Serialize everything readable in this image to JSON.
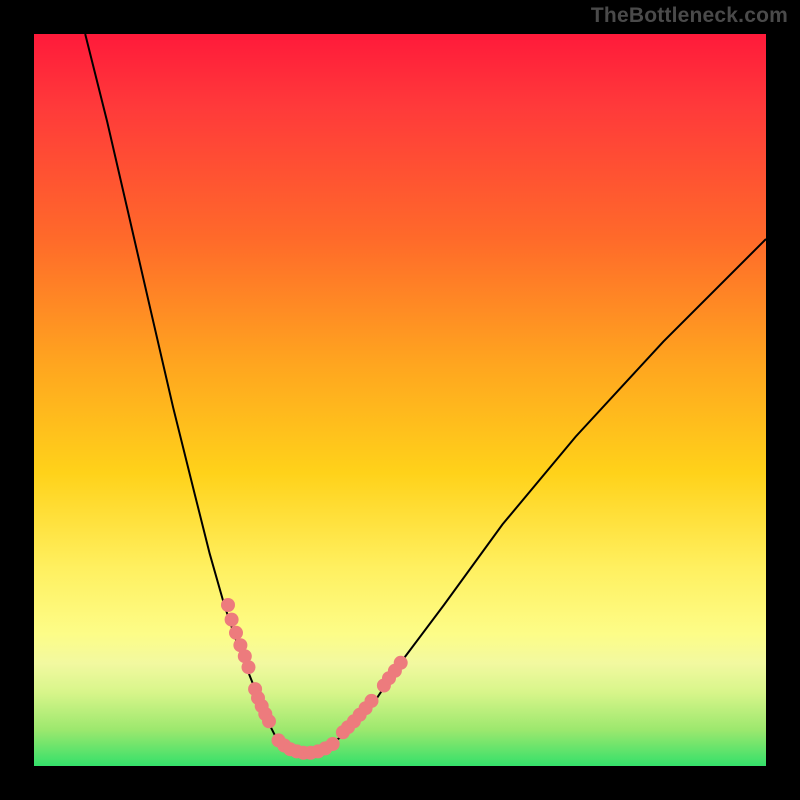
{
  "watermark": "TheBottleneck.com",
  "colors": {
    "background": "#000000",
    "gradient_top": "#ff1a3a",
    "gradient_mid": "#ffd21a",
    "gradient_bottom": "#34e06a",
    "curve": "#000000",
    "markers": "#ed7b7d",
    "watermark_text": "#4a4a4a"
  },
  "chart_data": {
    "type": "line",
    "title": "",
    "xlabel": "",
    "ylabel": "",
    "xlim": [
      0,
      100
    ],
    "ylim": [
      0,
      100
    ],
    "series": [
      {
        "name": "bottleneck-curve",
        "x": [
          7,
          10,
          13,
          16,
          19,
          22,
          24,
          26,
          28,
          30,
          31,
          32,
          33,
          34,
          35,
          37,
          39,
          42,
          46,
          50,
          56,
          64,
          74,
          86,
          100
        ],
        "y": [
          100,
          88,
          75,
          62,
          49,
          37,
          29,
          22,
          16,
          11,
          8,
          6,
          4,
          3,
          2,
          2,
          2,
          4,
          8,
          14,
          22,
          33,
          45,
          58,
          72
        ]
      }
    ],
    "markers": {
      "name": "highlighted-points",
      "segments": [
        {
          "x": [
            26.5,
            27.0,
            27.6,
            28.2,
            28.8,
            29.3
          ],
          "y": [
            22.0,
            20.0,
            18.2,
            16.5,
            15.0,
            13.5
          ]
        },
        {
          "x": [
            30.2,
            30.6,
            31.1,
            31.6,
            32.1
          ],
          "y": [
            10.5,
            9.3,
            8.2,
            7.1,
            6.1
          ]
        },
        {
          "x": [
            33.4,
            34.2,
            35.0,
            35.9,
            36.8,
            37.8,
            38.8,
            39.8,
            40.8
          ],
          "y": [
            3.5,
            2.8,
            2.3,
            2.0,
            1.8,
            1.8,
            2.0,
            2.4,
            3.0
          ]
        },
        {
          "x": [
            42.2,
            42.9,
            43.7,
            44.5,
            45.3,
            46.1
          ],
          "y": [
            4.6,
            5.3,
            6.1,
            7.0,
            7.9,
            8.9
          ]
        },
        {
          "x": [
            47.8,
            48.5,
            49.3,
            50.1
          ],
          "y": [
            11.0,
            12.0,
            13.0,
            14.1
          ]
        }
      ]
    },
    "annotations": []
  }
}
